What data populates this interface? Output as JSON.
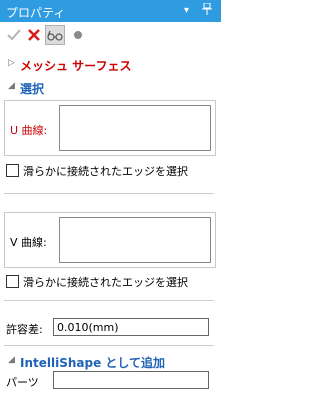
{
  "panel": {
    "title": "プロパティ",
    "pin_glyph": "▾",
    "pin2_glyph": "ᚚ"
  },
  "toolbar": {
    "ok_icon": "check-icon",
    "cancel_icon": "close-icon",
    "preview_icon": "glasses-icon",
    "dot_icon": "dot-icon"
  },
  "sections": {
    "mesh": {
      "label": "メッシュ サーフェス",
      "arrow": "▷",
      "color": "#cc0000"
    },
    "selection": {
      "label": "選択",
      "arrow": "◢",
      "color": "#1f62b8"
    },
    "intellishape": {
      "label": "IntelliShape として追加",
      "arrow": "◢",
      "color": "#1f62b8"
    }
  },
  "u_curve": {
    "label": "U 曲線:",
    "color": "#cc0000",
    "value": ""
  },
  "u_smooth": {
    "label": "滑らかに接続されたエッジを選択",
    "checked": false
  },
  "v_curve": {
    "label": "V 曲線:",
    "value": ""
  },
  "v_smooth": {
    "label": "滑らかに接続されたエッジを選択",
    "checked": false
  },
  "tolerance": {
    "label": "許容差:",
    "value": "0.010(mm)"
  },
  "parts": {
    "label": "パーツ",
    "value": ""
  }
}
